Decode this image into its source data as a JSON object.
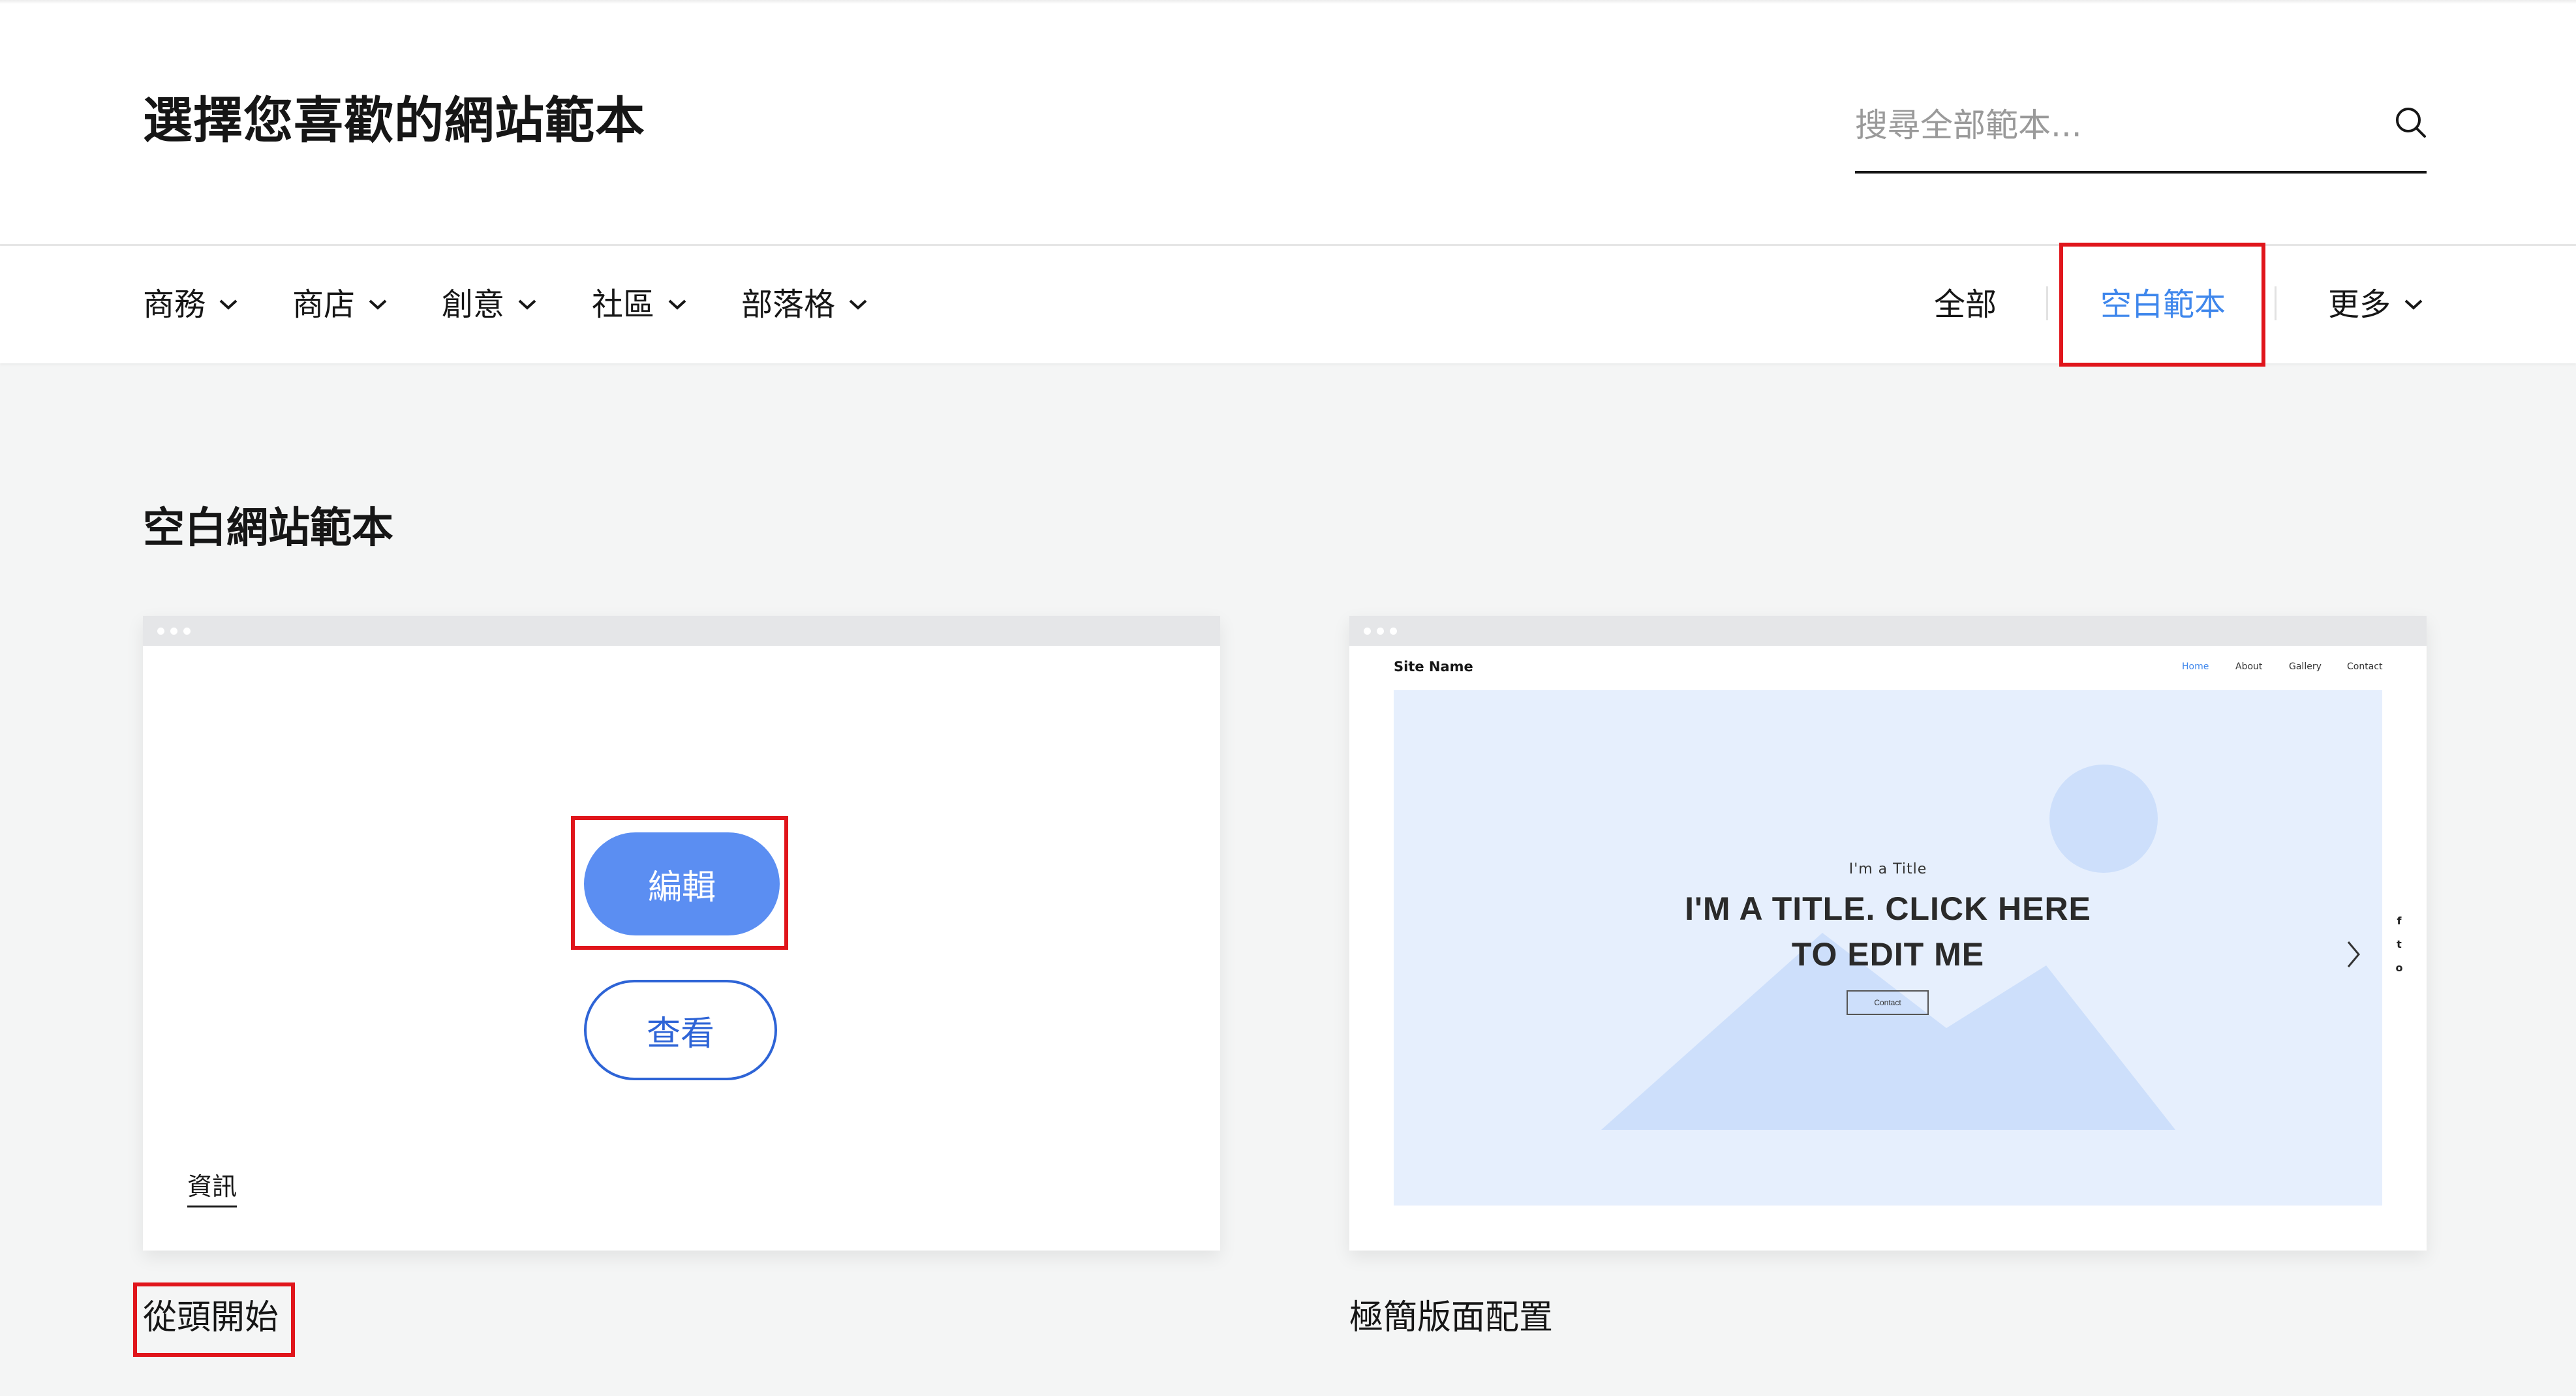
{
  "header": {
    "title": "選擇您喜歡的網站範本",
    "search": {
      "placeholder": "搜尋全部範本..."
    }
  },
  "nav": {
    "left": [
      {
        "label": "商務"
      },
      {
        "label": "商店"
      },
      {
        "label": "創意"
      },
      {
        "label": "社區"
      },
      {
        "label": "部落格"
      }
    ],
    "right": [
      {
        "label": "全部"
      },
      {
        "label": "空白範本",
        "active": true
      },
      {
        "label": "更多"
      }
    ]
  },
  "section": {
    "title": "空白網站範本"
  },
  "cards": [
    {
      "name": "從頭開始",
      "edit_label": "編輯",
      "view_label": "查看",
      "info_label": "資訊"
    },
    {
      "name": "極簡版面配置",
      "preview": {
        "site_name": "Site Name",
        "menu": [
          "Home",
          "About",
          "Gallery",
          "Contact"
        ],
        "kicker": "I'm a Title",
        "title_line1": "I'M A TITLE. CLICK HERE",
        "title_line2": "TO EDIT ME",
        "button": "Contact",
        "social": [
          "f",
          "t",
          "o"
        ]
      }
    }
  ],
  "colors": {
    "accent": "#3f87ec",
    "edit_button": "#5b8ef2",
    "view_button_border": "#2e64d6",
    "highlight_box": "#e0151b",
    "page_background": "#f4f5f5",
    "hero_background": "#e6effd"
  },
  "icons": {
    "search": "search-icon",
    "dropdown": "chevron-down-icon",
    "carousel_next": "chevron-right-icon"
  }
}
